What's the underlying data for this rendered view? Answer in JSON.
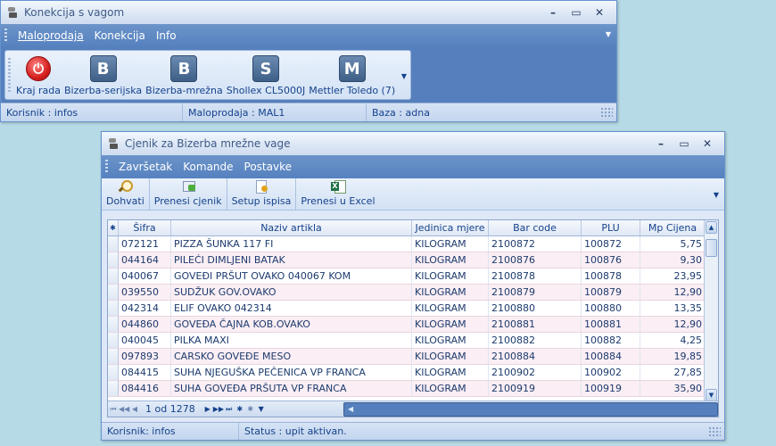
{
  "window1": {
    "title": "Konekcija s vagom",
    "menu": [
      "Maloprodaja",
      "Konekcija",
      "Info"
    ],
    "toolbar": [
      {
        "label": "Kraj rada",
        "icon": "power-icon",
        "glyph": "⏻"
      },
      {
        "label": "Bizerba-serijska",
        "icon": "b-icon",
        "glyph": "B"
      },
      {
        "label": "Bizerba-mrežna",
        "icon": "b-icon",
        "glyph": "B"
      },
      {
        "label": "Shollex CL5000J",
        "icon": "s-icon",
        "glyph": "S"
      },
      {
        "label": "Mettler Toledo (7)",
        "icon": "m-icon",
        "glyph": "M"
      }
    ],
    "status": [
      "Korisnik : infos",
      "Maloprodaja : MAL1",
      "Baza : adna"
    ]
  },
  "window2": {
    "title": "Cjenik za Bizerba mrežne vage",
    "menu": [
      "Završetak",
      "Komande",
      "Postavke"
    ],
    "toolbar": [
      "Dohvati",
      "Prenesi cjenik",
      "Setup ispisa",
      "Prenesi u Excel"
    ],
    "columns": [
      "Šifra",
      "Naziv artikla",
      "Jedinica mjere",
      "Bar code",
      "PLU",
      "Mp Cijena"
    ],
    "rows": [
      [
        "072121",
        "PIZZA ŠUNKA 117 FI",
        "KILOGRAM",
        "2100872",
        "100872",
        "5,75"
      ],
      [
        "044164",
        "PILEĆI DIMLJENI BATAK",
        "KILOGRAM",
        "2100876",
        "100876",
        "9,30"
      ],
      [
        "040067",
        "GOVEĐI PRŠUT OVAKO 040067 KOM",
        "KILOGRAM",
        "2100878",
        "100878",
        "23,95"
      ],
      [
        "039550",
        "SUDŽUK GOV.OVAKO",
        "KILOGRAM",
        "2100879",
        "100879",
        "12,90"
      ],
      [
        "042314",
        "ELIF OVAKO 042314",
        "KILOGRAM",
        "2100880",
        "100880",
        "13,35"
      ],
      [
        "044860",
        "GOVEĐA ČAJNA KOB.OVAKO",
        "KILOGRAM",
        "2100881",
        "100881",
        "12,90"
      ],
      [
        "040045",
        "PILKA MAXI",
        "KILOGRAM",
        "2100882",
        "100882",
        "4,25"
      ],
      [
        "097893",
        "CARSKO GOVEĐE MESO",
        "KILOGRAM",
        "2100884",
        "100884",
        "19,85"
      ],
      [
        "084415",
        "SUHA NJEGUŠKA PEČENICA VP FRANCA",
        "KILOGRAM",
        "2100902",
        "100902",
        "27,85"
      ],
      [
        "084416",
        "SUHA GOVEĐA PRŠUTA VP FRANCA",
        "KILOGRAM",
        "2100919",
        "100919",
        "35,90"
      ]
    ],
    "navigator": {
      "position": "1 od 1278"
    },
    "status": [
      "Korisnik: infos",
      "Status : upit aktivan."
    ]
  }
}
